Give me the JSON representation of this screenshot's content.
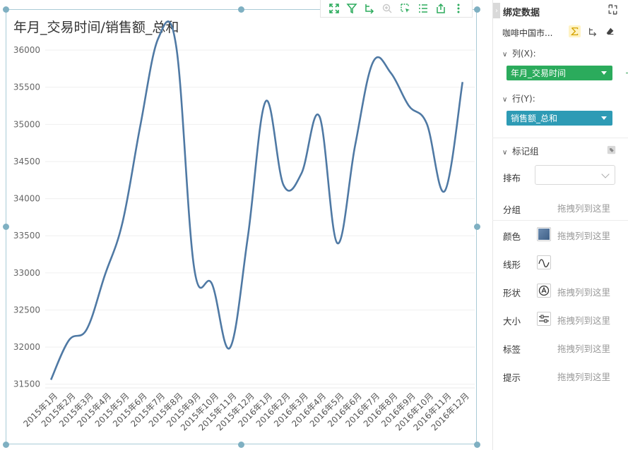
{
  "chart_card": {
    "title": "年月_交易时间/销售额_总和"
  },
  "toolbar": {
    "icons": [
      "fullscreen-icon",
      "filter-icon",
      "drill-icon",
      "zoom-icon",
      "select-icon",
      "list-icon",
      "export-icon",
      "more-icon"
    ]
  },
  "chart_data": {
    "type": "line",
    "title": "年月_交易时间/销售额_总和",
    "xlabel": "",
    "ylabel": "",
    "categories": [
      "2015年1月",
      "2015年2月",
      "2015年3月",
      "2015年4月",
      "2015年5月",
      "2015年6月",
      "2015年7月",
      "2015年8月",
      "2015年9月",
      "2015年10月",
      "2015年11月",
      "2015年12月",
      "2016年1月",
      "2016年2月",
      "2016年3月",
      "2016年4月",
      "2016年5月",
      "2016年6月",
      "2016年7月",
      "2016年8月",
      "2016年9月",
      "2016年10月",
      "2016年11月",
      "2016年12月"
    ],
    "series": [
      {
        "values": [
          31560,
          32090,
          32240,
          32960,
          33680,
          34990,
          36160,
          36050,
          33070,
          32850,
          31990,
          33480,
          35310,
          34180,
          34340,
          35110,
          33400,
          34720,
          35840,
          35690,
          35250,
          35010,
          34100,
          35570
        ]
      }
    ],
    "ylim": [
      31450,
      36200
    ],
    "yticks": [
      31500,
      32000,
      32500,
      33000,
      33500,
      34000,
      34500,
      35000,
      35500,
      36000
    ],
    "grid": true,
    "line_color": "#4f79a4"
  },
  "panel": {
    "title": "绑定数据",
    "datasource": "咖啡中国市...",
    "columns_label": "列(X):",
    "columns_field": "年月_交易时间",
    "rows_label": "行(Y):",
    "rows_field": "销售额_总和",
    "marks_label": "标记组",
    "layout_label": "排布",
    "properties": [
      {
        "label": "分组",
        "drop": "拖拽列到这里"
      },
      {
        "label": "颜色",
        "drop": "拖拽列到这里"
      },
      {
        "label": "线形",
        "drop": ""
      },
      {
        "label": "形状",
        "drop": "拖拽列到这里"
      },
      {
        "label": "大小",
        "drop": "拖拽列到这里"
      },
      {
        "label": "标签",
        "drop": "拖拽列到这里"
      },
      {
        "label": "提示",
        "drop": "拖拽列到这里"
      }
    ],
    "colors": {
      "columns_pill": "#2bab5c",
      "rows_pill": "#2e9bb5"
    }
  }
}
